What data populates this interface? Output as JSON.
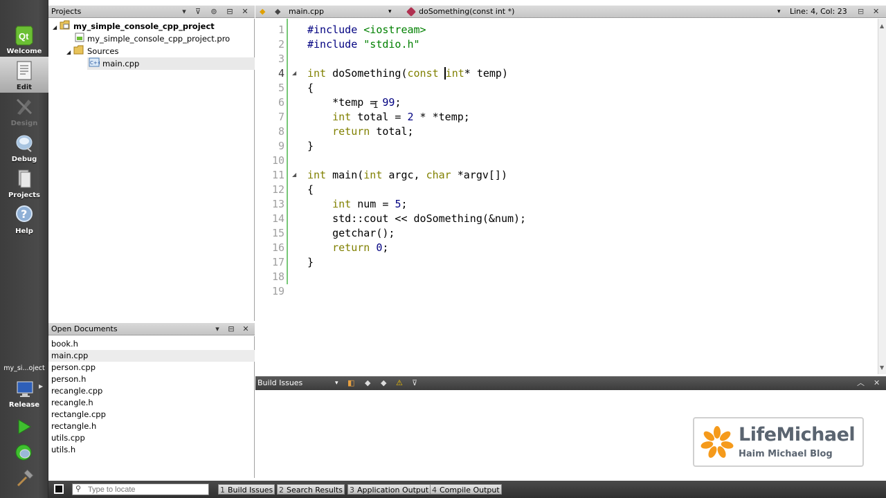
{
  "modes": [
    {
      "label": "Welcome",
      "icon": "qt-logo-icon",
      "state": "normal"
    },
    {
      "label": "Edit",
      "icon": "edit-document-icon",
      "state": "active"
    },
    {
      "label": "Design",
      "icon": "design-pen-icon",
      "state": "disabled"
    },
    {
      "label": "Debug",
      "icon": "bug-icon",
      "state": "normal"
    },
    {
      "label": "Projects",
      "icon": "projects-icon",
      "state": "normal"
    },
    {
      "label": "Help",
      "icon": "help-icon",
      "state": "normal"
    }
  ],
  "kit": {
    "project_short": "my_si...oject",
    "build_config": "Release"
  },
  "projects_pane": {
    "title": "Projects",
    "tree": [
      {
        "label": "my_simple_console_cpp_project",
        "bold": true
      },
      {
        "label": "my_simple_console_cpp_project.pro"
      },
      {
        "label": "Sources"
      },
      {
        "label": "main.cpp"
      }
    ]
  },
  "open_documents": {
    "title": "Open Documents",
    "items": [
      "book.h",
      "main.cpp",
      "person.cpp",
      "person.h",
      "recangle.cpp",
      "recangle.h",
      "rectangle.cpp",
      "rectangle.h",
      "utils.cpp",
      "utils.h"
    ],
    "selected": "main.cpp"
  },
  "editor_toolbar": {
    "file": "main.cpp",
    "symbol": "doSomething(const int *)",
    "position": "Line: 4, Col: 23"
  },
  "editor": {
    "line_numbers": [
      "1",
      "2",
      "3",
      "4",
      "5",
      "6",
      "7",
      "8",
      "9",
      "10",
      "11",
      "12",
      "13",
      "14",
      "15",
      "16",
      "17",
      "18",
      "19"
    ],
    "current_line": 4
  },
  "build_issues": {
    "title": "Build Issues"
  },
  "locator": {
    "placeholder": "Type to locate"
  },
  "output_tabs": [
    {
      "num": "1",
      "label": "Build Issues"
    },
    {
      "num": "2",
      "label": "Search Results"
    },
    {
      "num": "3",
      "label": "Application Output"
    },
    {
      "num": "4",
      "label": "Compile Output"
    }
  ],
  "watermark": {
    "brand": "LifeMichael",
    "subtitle": "Haim Michael Blog"
  },
  "colors": {
    "keyword": "#808000",
    "preprocessor": "#000080",
    "string": "#008000",
    "number": "#000080",
    "fold_marker": "#78c878"
  }
}
